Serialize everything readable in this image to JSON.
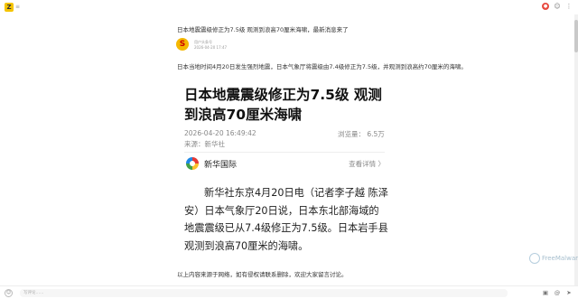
{
  "topbar": {
    "app_logo_text": "Z",
    "menu_glyph": "≡",
    "icons": [
      "notification-icon",
      "profile-icon",
      "more-icon"
    ]
  },
  "post": {
    "title": "日本地震震级修正为7.5级 观测到浪高70厘米海啸，最新消息来了",
    "author_avatar_text": "S",
    "author_name": "用户头条号",
    "author_time": "2026-04-20 17:47",
    "intro": "日本当地时间4月20日发生强烈地震，日本气象厅将震级由7.4级修正为7.5级，并观测到浪高约70厘米的海啸。"
  },
  "article": {
    "title": "日本地震震级修正为7.5级 观测到浪高70厘米海啸",
    "date": "2026-04-20 16:49:42",
    "views": "浏览量：  6.5万",
    "source": "来源：新华社",
    "agency_name": "新华国际",
    "more_link": "查看详情 〉",
    "body": "新华社东京4月20日电（记者李子越 陈泽安）日本气象厅20日说，日本东北部海域的地震震级已从7.4级修正为7.5级。日本岩手县观测到浪高70厘米的海啸。"
  },
  "footer_text": "以上内容来源于网络，如有侵权请联系删除，欢迎大家留言讨论。",
  "watermark": "FreeMalware",
  "bottombar": {
    "input_placeholder": "写评论……"
  },
  "colors": {
    "accent": "#f5c400",
    "red": "#e84a3f",
    "text": "#222222",
    "muted": "#888888"
  }
}
